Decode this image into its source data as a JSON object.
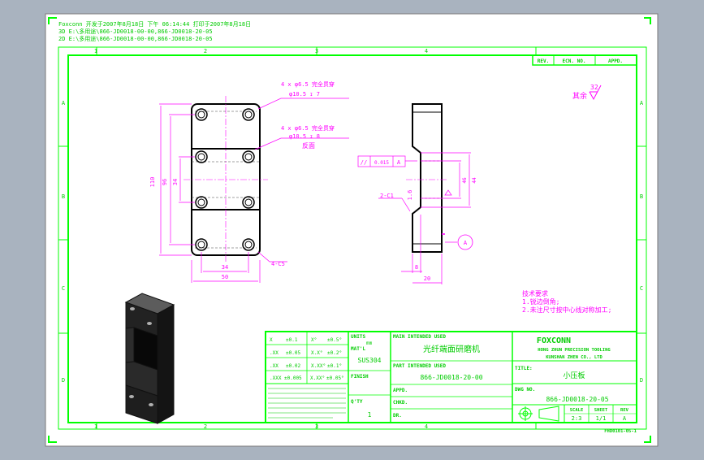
{
  "header": {
    "line1": "Foxconn  开发于2007年8月18日 下午 06:14:44  打印于2007年8月18日",
    "line2": "3D   E:\\多用途\\866-JD0018-00-00,866-JD0018-20-05",
    "line3": "2D   E:\\多用途\\866-JD0018-00-00,866-JD0018-20-05"
  },
  "border_zones": {
    "columns": [
      "1",
      "2",
      "3",
      "4",
      "5"
    ],
    "rows": [
      "A",
      "B",
      "C",
      "D"
    ]
  },
  "revision_block": {
    "rev": "REV.",
    "ecn": "ECN. NO.",
    "appd": "APPD."
  },
  "surface_finish": {
    "label": "其余",
    "value": "32"
  },
  "callouts": {
    "hole1_a": "4 x φ6.5 完全贯穿",
    "hole1_b": "φ10.5 ↧ 7",
    "hole2_a": "4 x φ6.5 完全贯穿",
    "hole2_b": "φ10.5 ↧ 8",
    "hole2_c": "反面",
    "chamfer_corner": "4-C5",
    "chamfer_side": "2-C1",
    "tolerance_symbol": "//",
    "tolerance_value": "0.015",
    "tolerance_datum": "A",
    "datum_label": "A"
  },
  "dimensions": {
    "overall_height": "110",
    "inner_height": "96",
    "hole_spacing": "34",
    "hole_width": "34",
    "overall_width": "50",
    "side_w1": "8",
    "side_w2": "20",
    "side_h1": "46",
    "side_h2": "44",
    "side_angle": "1.6"
  },
  "notes": {
    "title": "技术要求",
    "line1": "1.锐边倒角;",
    "line2": "2.未注尺寸按中心线对称加工;"
  },
  "title_block": {
    "tol_rows": [
      [
        "X",
        "±0.1",
        "X°",
        "±0.5°"
      ],
      [
        ".XX",
        "±0.05",
        "X.X°",
        "±0.2°"
      ],
      [
        ".XX",
        "±0.02",
        "X.XX°",
        "±0.1°"
      ],
      [
        ".XXX",
        "±0.005",
        "X.XX°",
        "±0.05°"
      ]
    ],
    "units_label": "UNITS",
    "units_value": "mm",
    "material_label": "MAT'L",
    "material_value": "SUS304",
    "finish_label": "FINISH",
    "qty_label": "Q'TY",
    "qty_value": "1",
    "main_used_label": "MAIN INTENDED USED",
    "main_used_value": "光纤端面研磨机",
    "part_label": "PART INTENDED USED",
    "part_value": "866-JD0018-20-00",
    "appd_label": "APPD.",
    "chkd_label": "CHKD.",
    "dr_label": "DR.",
    "company": "FOXCONN",
    "company_sub1": "HONG ZHUN PRECISION TOOLING",
    "company_sub2": "KUNSHAN ZHEN CO., LTD",
    "title_label": "TITLE:",
    "title_value": "小压板",
    "dwg_label": "DWG NO.",
    "dwg_value": "866-JD0018-20-05",
    "scale_label": "SCALE",
    "scale_value": "2:3",
    "sheet_label": "SHEET",
    "sheet_value": "1/1",
    "rev_label": "REV",
    "rev_value": "A",
    "form_code": "FHD0101-05-1"
  },
  "colors": {
    "frame": "#00ff00",
    "annotation": "#ff00ff",
    "geometry": "#000000",
    "sheet": "#ffffff",
    "background": "#a9b3bf"
  }
}
